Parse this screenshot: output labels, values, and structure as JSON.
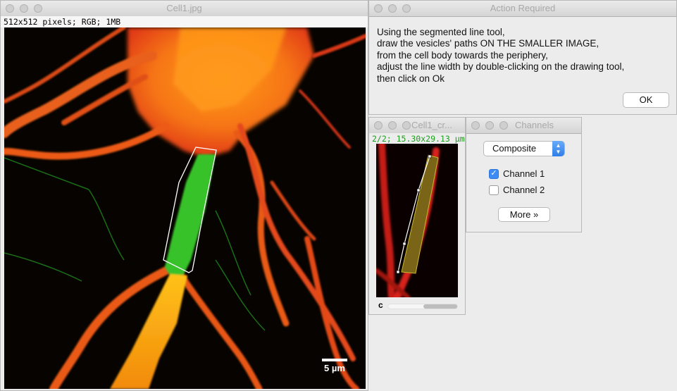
{
  "main_window": {
    "title": "Cell1.jpg",
    "info": "512x512 pixels; RGB; 1MB",
    "scale_bar_label": "5 µm"
  },
  "action_dialog": {
    "title": "Action Required",
    "lines": [
      "Using the segmented line tool,",
      "draw the vesicles' paths ON THE SMALLER IMAGE,",
      "from the cell body towards the periphery,",
      "adjust the line width by double-clicking on the drawing tool,",
      "then click on Ok"
    ],
    "ok_label": "OK"
  },
  "crop_window": {
    "title": "Cell1_cr...",
    "info": "2/2; 15.30x29.13 µm",
    "channel_letter": "c"
  },
  "channels_panel": {
    "title": "Channels",
    "mode": "Composite",
    "channel1_label": "Channel 1",
    "channel1_checked": true,
    "channel2_label": "Channel 2",
    "channel2_checked": false,
    "more_label": "More »"
  },
  "colors": {
    "info_green": "#19a019",
    "checkbox_blue": "#3d8bf5",
    "image_red": "#e83018",
    "image_orange": "#ff8a10",
    "image_green": "#35c22a"
  }
}
